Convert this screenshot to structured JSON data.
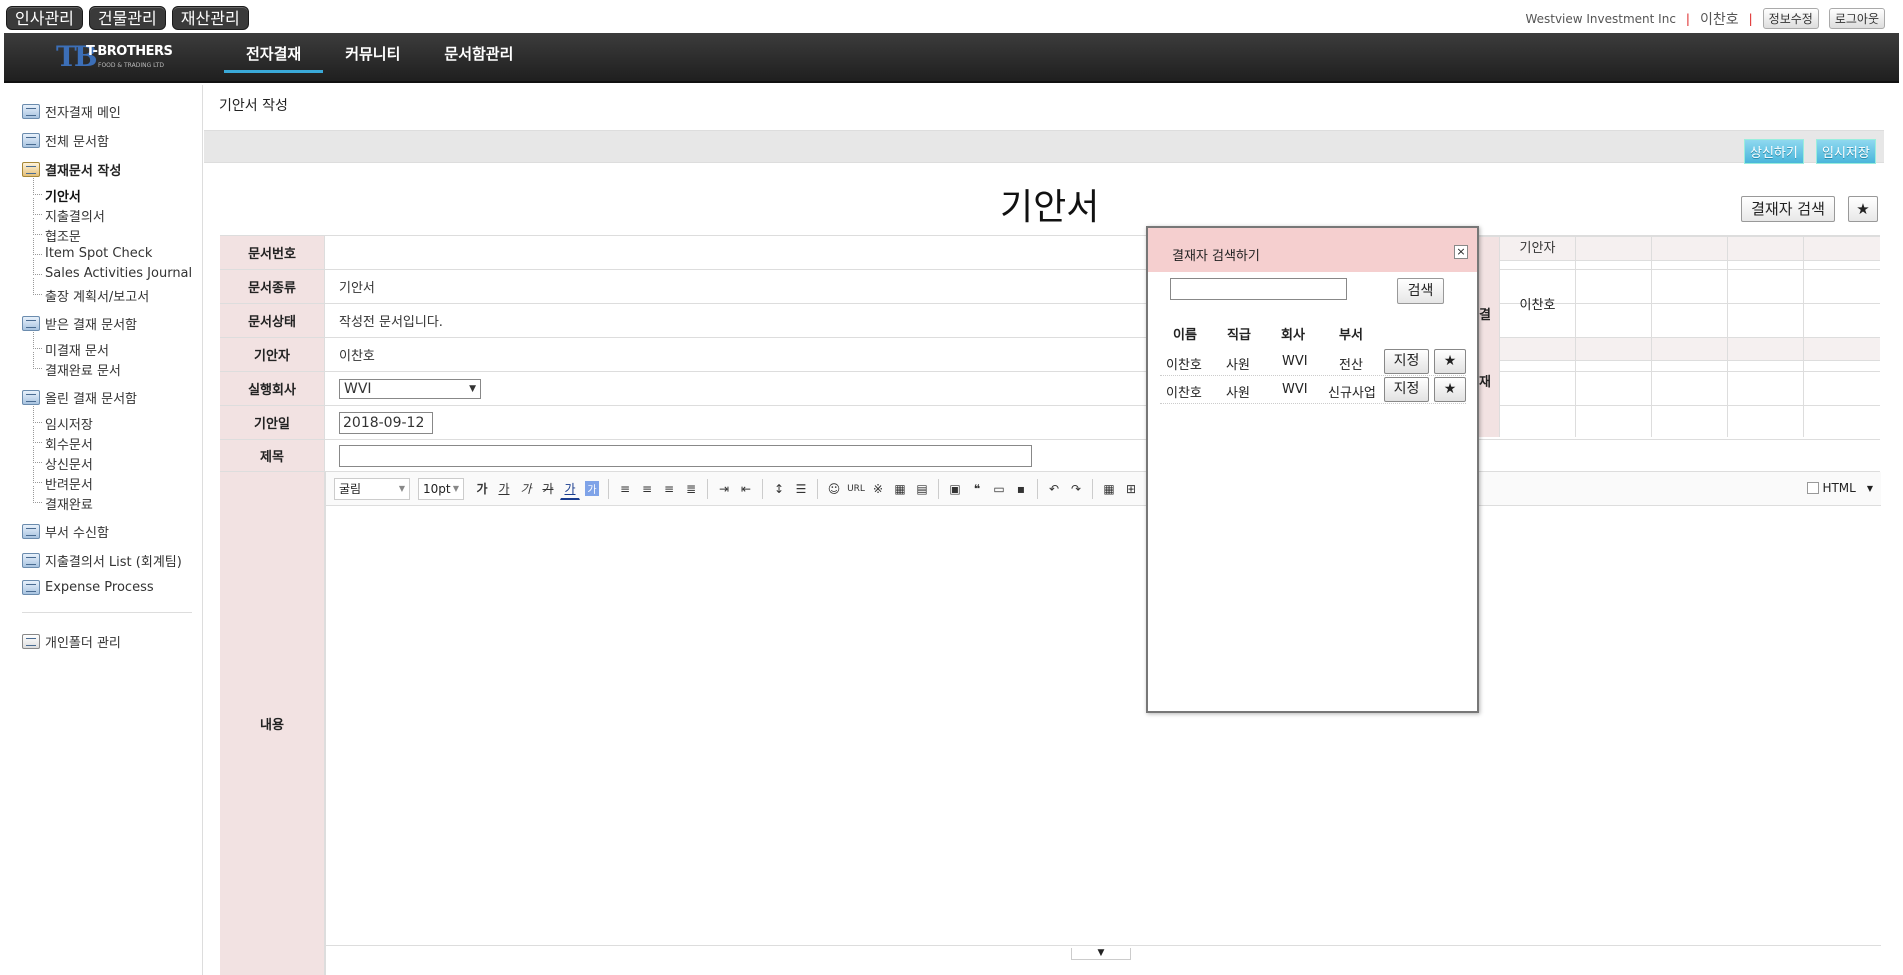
{
  "system_menu": [
    "인사관리",
    "건물관리",
    "재산관리"
  ],
  "user": {
    "company": "Westview Investment Inc",
    "name": "이찬호",
    "edit_info": "정보수정",
    "logout": "로그아웃"
  },
  "logo": {
    "mark": "TB",
    "name": "T-BROTHERS",
    "sub": "FOOD & TRADING LTD"
  },
  "nav": [
    "전자결재",
    "커뮤니티",
    "문서함관리"
  ],
  "sidebar": {
    "groups": [
      {
        "label": "전자결재 메인"
      },
      {
        "label": "전체 문서함"
      },
      {
        "label": "결재문서 작성",
        "children": [
          "기안서",
          "지출결의서",
          "협조문",
          "Item Spot Check",
          "Sales Activities Journal",
          "출장 계획서/보고서"
        ]
      },
      {
        "label": "받은 결재 문서함",
        "children": [
          "미결재 문서",
          "결재완료 문서"
        ]
      },
      {
        "label": "올린 결재 문서함",
        "children": [
          "임시저장",
          "회수문서",
          "상신문서",
          "반려문서",
          "결재완료"
        ]
      },
      {
        "label": "부서 수신함"
      },
      {
        "label": "지출결의서 List (회계팀)"
      },
      {
        "label": "Expense Process"
      },
      {
        "label": "개인폴더 관리"
      }
    ]
  },
  "page": {
    "breadcrumb": "기안서 작성",
    "submit_btn": "상신하기",
    "temp_save_btn": "임시저장",
    "doc_title": "기안서",
    "approver_search_btn": "결재자 검색",
    "star_btn": "★"
  },
  "form": {
    "doc_no_label": "문서번호",
    "doc_no": "",
    "doc_type_label": "문서종류",
    "doc_type": "기안서",
    "doc_status_label": "문서상태",
    "doc_status": "작성전 문서입니다.",
    "drafter_label": "기안자",
    "drafter": "이찬호",
    "company_label": "실행회사",
    "company": "WVI",
    "date_label": "기안일",
    "date": "2018-09-12",
    "subject_label": "제목",
    "subject": "",
    "content_label": "내용"
  },
  "editor": {
    "font": "굴림",
    "size": "10pt",
    "html_label": "HTML"
  },
  "approval": {
    "side_top": "결",
    "side_bottom": "재",
    "drafter_head": "기안자",
    "drafter_name": "이찬호"
  },
  "modal": {
    "title": "결재자 검색하기",
    "close": "×",
    "search_btn": "검색",
    "headers": [
      "이름",
      "직급",
      "회사",
      "부서"
    ],
    "rows": [
      {
        "name": "이찬호",
        "rank": "사원",
        "company": "WVI",
        "dept": "전산",
        "assign": "지정",
        "star": "★"
      },
      {
        "name": "이찬호",
        "rank": "사원",
        "company": "WVI",
        "dept": "신규사업",
        "assign": "지정",
        "star": "★"
      }
    ]
  }
}
